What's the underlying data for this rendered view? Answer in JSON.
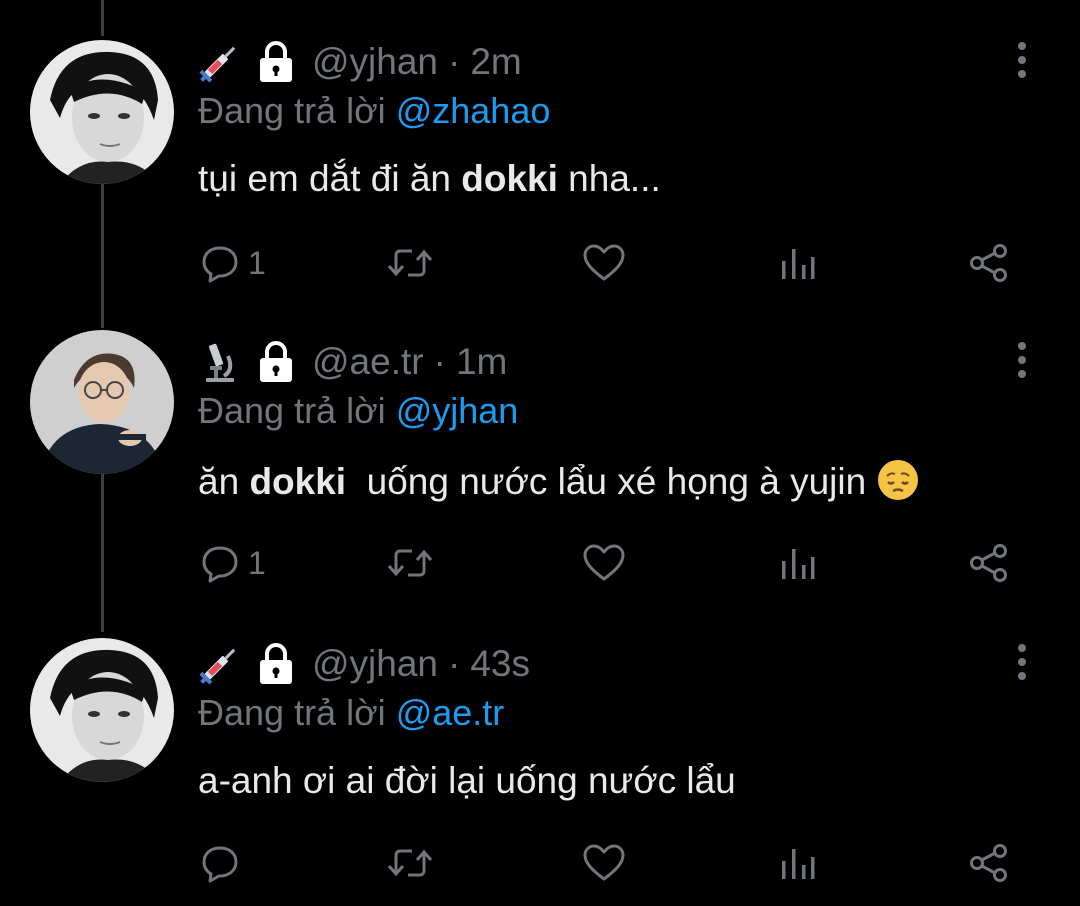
{
  "tweets": [
    {
      "badge_icon": "syringe-icon",
      "handle": "@yjhan",
      "separator": "·",
      "time": "2m",
      "reply_prefix": "Đang trả lời",
      "reply_to": "@zhahao",
      "text_before": "tụi em dắt đi ăn ",
      "text_bold": "dokki",
      "text_after": " nha...",
      "reply_count": "1",
      "avatar": "person-boy-avatar"
    },
    {
      "badge_icon": "microscope-icon",
      "handle": "@ae.tr",
      "separator": "·",
      "time": "1m",
      "reply_prefix": "Đang trả lời",
      "reply_to": "@yjhan",
      "text_before": "ăn ",
      "text_bold": "dokki",
      "text_after": "  uống nước lẩu xé họng à yujin",
      "trailing_emoji": "pensive-face-emoji",
      "reply_count": "1",
      "avatar": "person-glasses-avatar"
    },
    {
      "badge_icon": "syringe-icon",
      "handle": "@yjhan",
      "separator": "·",
      "time": "43s",
      "reply_prefix": "Đang trả lời",
      "reply_to": "@ae.tr",
      "text_before": "a-anh ơi ai đời lại uống nước lẩu",
      "text_bold": "",
      "text_after": "",
      "reply_count": "",
      "avatar": "person-boy-avatar"
    }
  ],
  "colors": {
    "background": "#000000",
    "muted": "#71767b",
    "mention": "#1d9bf0",
    "text": "#e7e9ea"
  }
}
